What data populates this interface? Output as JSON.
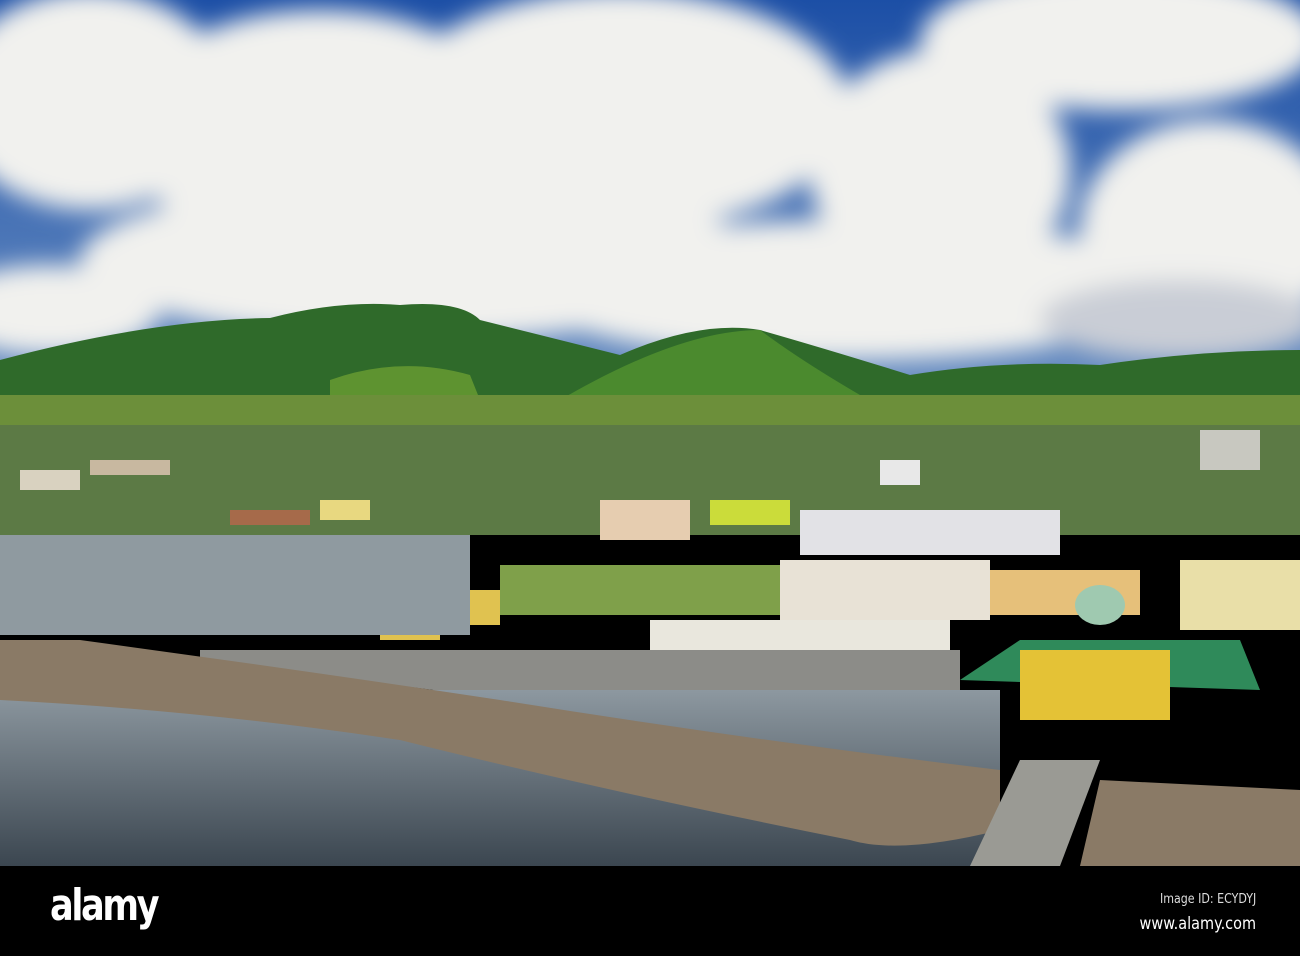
{
  "banner": {
    "logo": "alamy",
    "image_id": "Image ID: ECYDYJ",
    "site": "www.alamy.com"
  },
  "colors": {
    "sky": "#2356a8",
    "cloud": "#f2f2ef",
    "mountain": "#2f6a2a",
    "water": "#4a5560",
    "rocks": "#8a7a66"
  }
}
